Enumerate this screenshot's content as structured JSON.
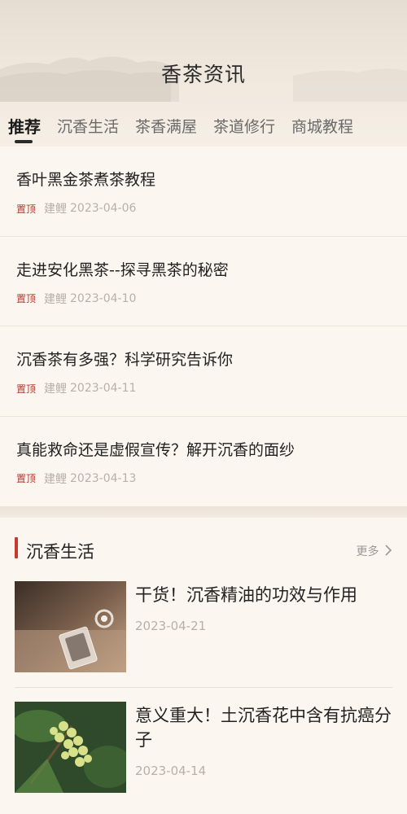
{
  "header": {
    "title": "香茶资讯"
  },
  "tabs": [
    {
      "label": "推荐",
      "active": true
    },
    {
      "label": "沉香生活"
    },
    {
      "label": "茶香满屋"
    },
    {
      "label": "茶道修行"
    },
    {
      "label": "商城教程"
    }
  ],
  "news": [
    {
      "title": "香叶黑金茶煮茶教程",
      "pin": "置顶",
      "author": "建鲤",
      "date": "2023-04-06"
    },
    {
      "title": "走进安化黑茶--探寻黑茶的秘密",
      "pin": "置顶",
      "author": "建鲤",
      "date": "2023-04-10"
    },
    {
      "title": "沉香茶有多强？科学研究告诉你",
      "pin": "置顶",
      "author": "建鲤",
      "date": "2023-04-11"
    },
    {
      "title": "真能救命还是虚假宣传？解开沉香的面纱",
      "pin": "置顶",
      "author": "建鲤",
      "date": "2023-04-13"
    }
  ],
  "section": {
    "title": "沉香生活",
    "more_label": "更多",
    "accent_color": "#c43a2e",
    "articles": [
      {
        "title": "干货！沉香精油的功效与作用",
        "date": "2023-04-21"
      },
      {
        "title": "意义重大！土沉香花中含有抗癌分子",
        "date": "2023-04-14"
      }
    ]
  }
}
